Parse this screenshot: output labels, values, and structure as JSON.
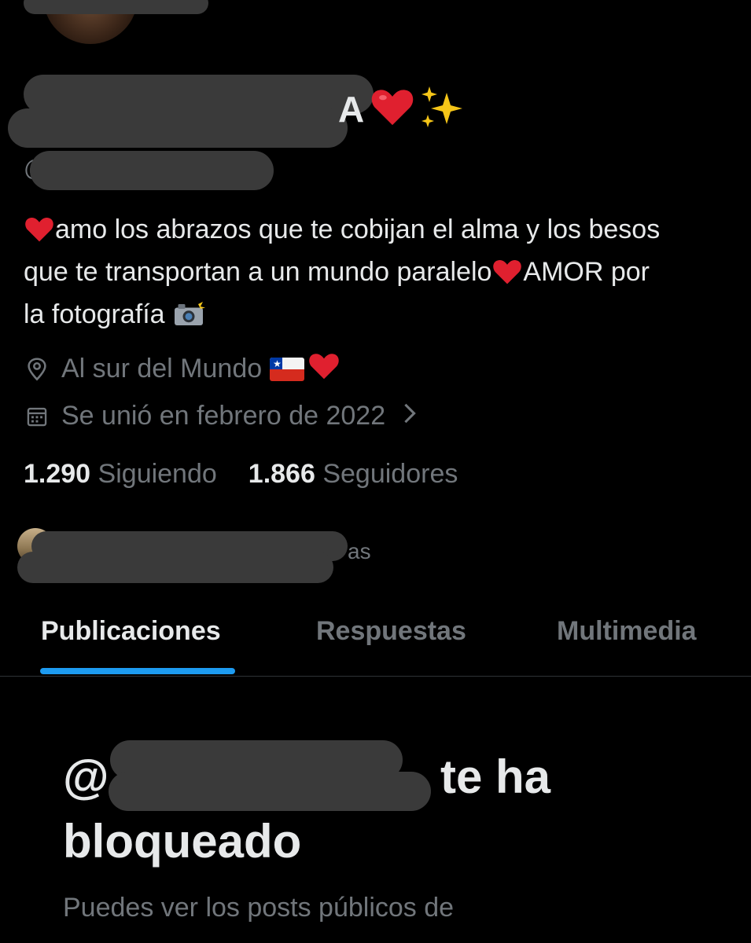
{
  "profile": {
    "name_visible_tail": "A",
    "bio": {
      "line1": "amo los abrazos que te cobijan el alma y los besos",
      "line2": "que te transportan a un mundo paralelo",
      "line2_end": "AMOR por",
      "line3": "la fotografía"
    },
    "location": "Al sur del Mundo",
    "joined": "Se unió en febrero de 2022",
    "following_count": "1.290",
    "following_label": "Siguiendo",
    "followers_count": "1.866",
    "followers_label": "Seguidores",
    "followed_by_tail": "as"
  },
  "tabs": [
    {
      "label": "Publicaciones",
      "active": true
    },
    {
      "label": "Respuestas",
      "active": false
    },
    {
      "label": "Multimedia",
      "active": false
    }
  ],
  "blocked": {
    "title_prefix": "@",
    "title_tail": "te ha",
    "title_line2": "bloqueado",
    "description": "Puedes ver los posts públicos de"
  },
  "colors": {
    "background": "#000000",
    "text_primary": "#e7e9ea",
    "text_secondary": "#71767b",
    "accent": "#1d9bf0",
    "redaction": "#3a3a3a"
  },
  "icons": {
    "heart": "heart-icon",
    "sparkles": "sparkles-icon",
    "camera": "camera-flash-icon",
    "location": "location-pin-icon",
    "calendar": "calendar-icon",
    "chevron": "chevron-right-icon",
    "flag": "chile-flag-icon"
  }
}
